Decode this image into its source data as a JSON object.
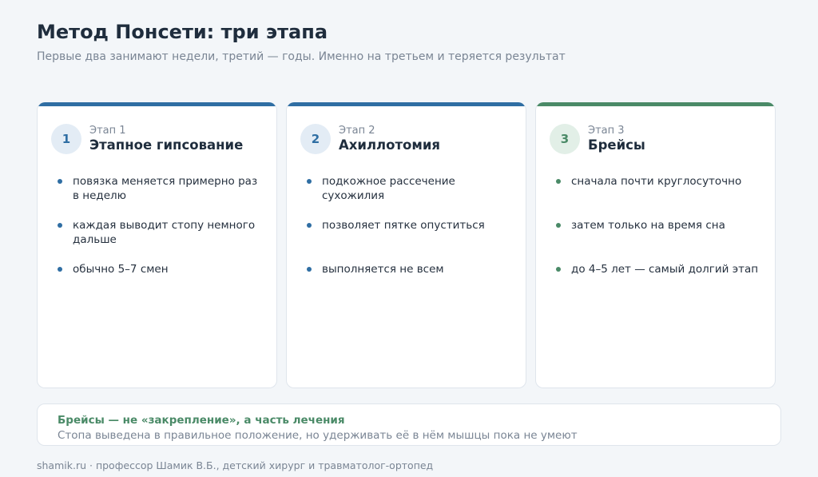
{
  "header": {
    "title": "Метод Понсети: три этапа",
    "subtitle": "Первые два занимают недели, третий — годы. Именно на третьем и теряется результат"
  },
  "colors": {
    "blue": "#2f6ea3",
    "blue_badge_bg": "#e3ecf5",
    "green": "#4a8a67",
    "green_badge_bg": "#e2efe7"
  },
  "stages": [
    {
      "number": "1",
      "label": "Этап 1",
      "name": "Этапное гипсование",
      "color": "#2f6ea3",
      "badge_bg": "#e3ecf5",
      "bullets": [
        "повязка меняется примерно раз в неделю",
        "каждая выводит стопу немного дальше",
        "обычно 5–7 смен"
      ]
    },
    {
      "number": "2",
      "label": "Этап 2",
      "name": "Ахиллотомия",
      "color": "#2f6ea3",
      "badge_bg": "#e3ecf5",
      "bullets": [
        "подкожное рассечение сухожилия",
        "позволяет пятке опуститься",
        "выполняется не всем"
      ]
    },
    {
      "number": "3",
      "label": "Этап 3",
      "name": "Брейсы",
      "color": "#4a8a67",
      "badge_bg": "#e2efe7",
      "bullets": [
        "сначала почти круглосуточно",
        "затем только на время сна",
        "до 4–5 лет — самый долгий этап"
      ]
    }
  ],
  "note": {
    "title": "Брейсы — не «закрепление», а часть лечения",
    "text": "Стопа выведена в правильное положение, но удерживать её в нём мышцы пока не умеют"
  },
  "footer": "shamik.ru · профессор Шамик В.Б., детский хирург и травматолог-ортопед"
}
